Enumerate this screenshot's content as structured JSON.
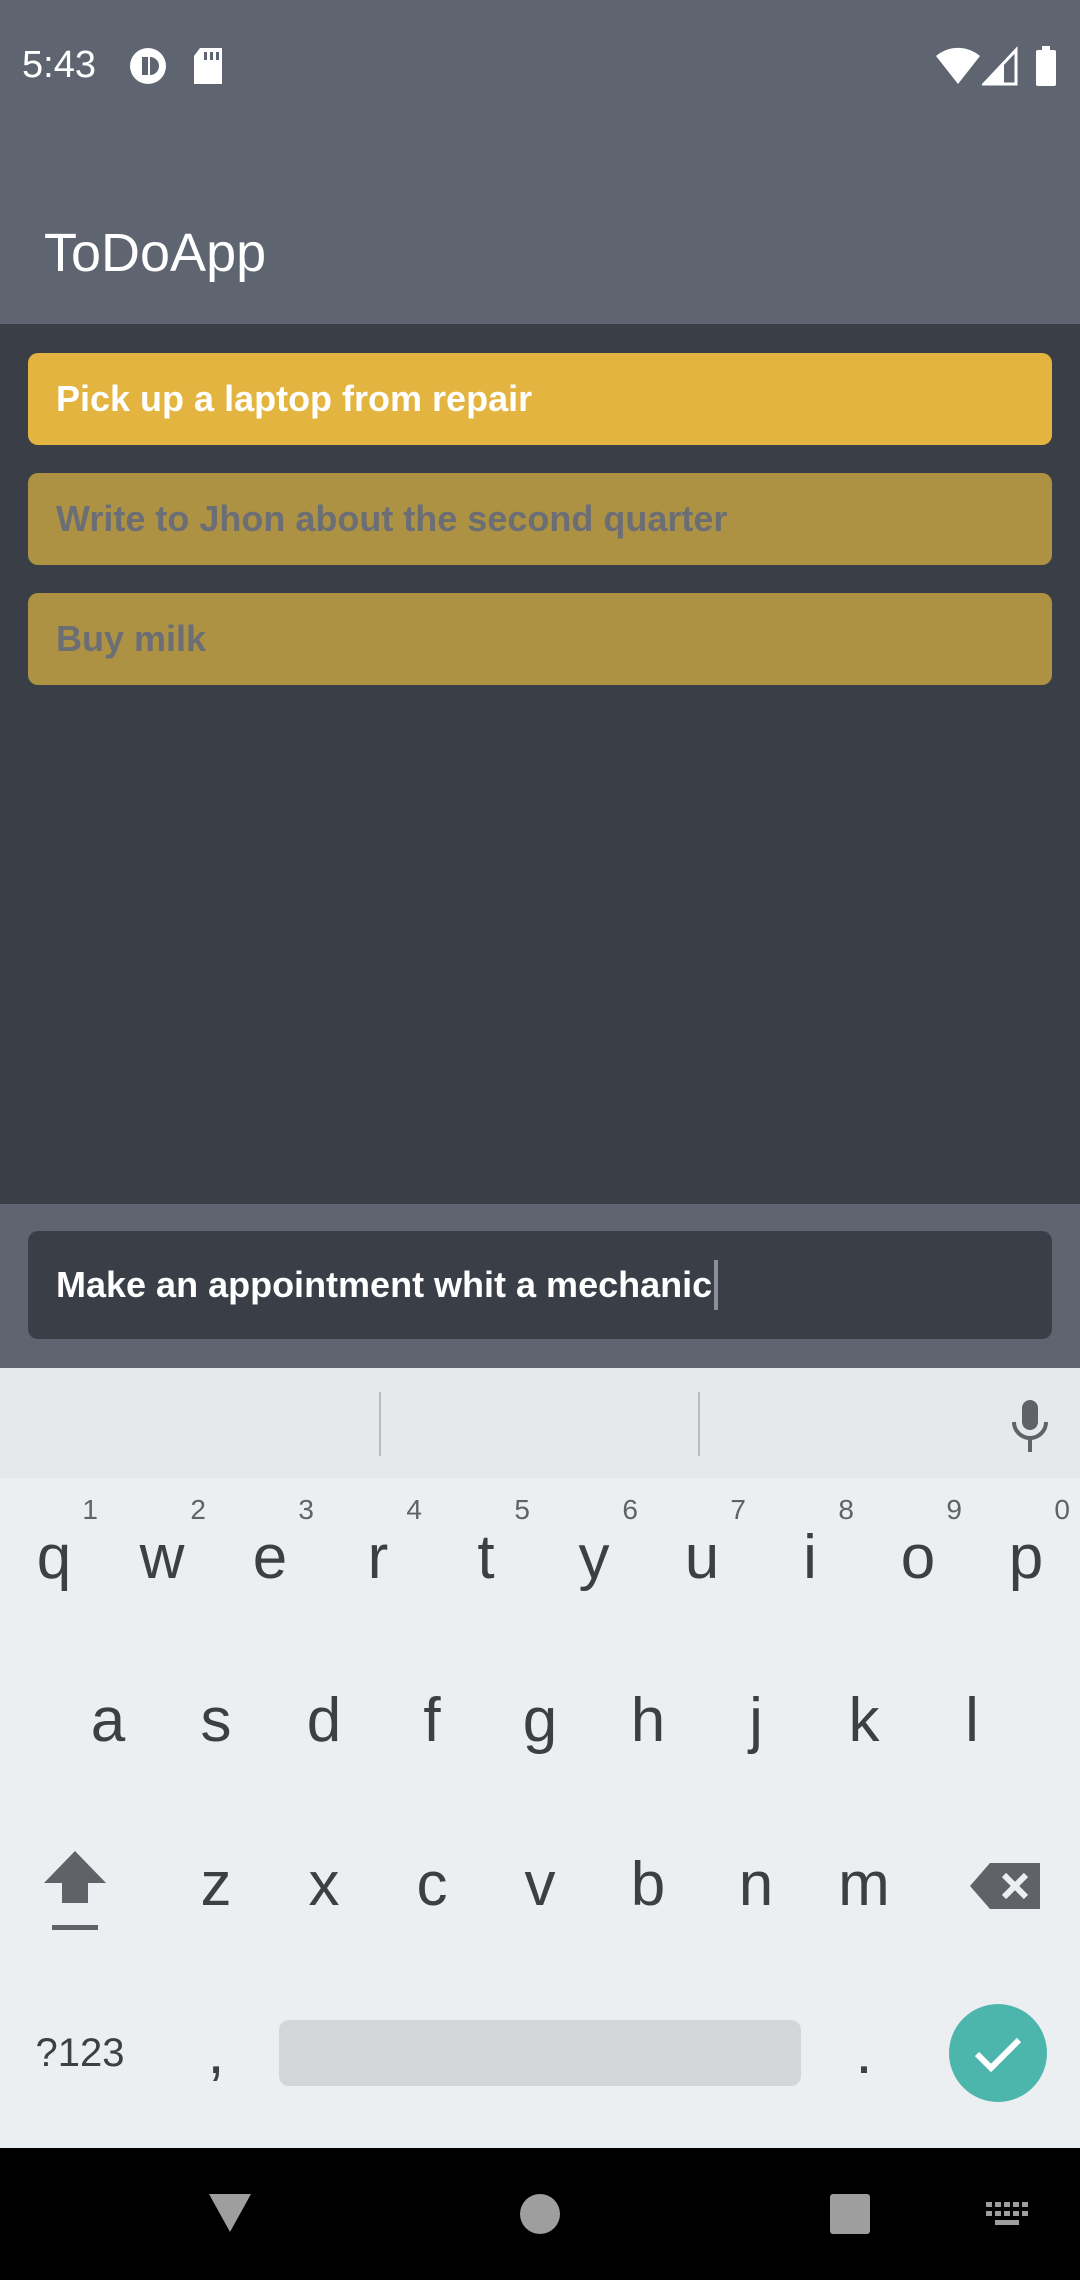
{
  "status_bar": {
    "time": "5:43",
    "icons": [
      "app-notification-icon",
      "sd-card-icon",
      "wifi-icon",
      "signal-icon",
      "battery-icon"
    ]
  },
  "app": {
    "title": "ToDoApp"
  },
  "todos": [
    {
      "text": "Pick up a laptop from repair",
      "state": "active"
    },
    {
      "text": "Write to Jhon about the second quarter",
      "state": "done"
    },
    {
      "text": "Buy milk",
      "state": "done"
    }
  ],
  "input": {
    "value": "Make an appointment whit a mechanic"
  },
  "keyboard": {
    "row1": [
      {
        "key": "q",
        "hint": "1"
      },
      {
        "key": "w",
        "hint": "2"
      },
      {
        "key": "e",
        "hint": "3"
      },
      {
        "key": "r",
        "hint": "4"
      },
      {
        "key": "t",
        "hint": "5"
      },
      {
        "key": "y",
        "hint": "6"
      },
      {
        "key": "u",
        "hint": "7"
      },
      {
        "key": "i",
        "hint": "8"
      },
      {
        "key": "o",
        "hint": "9"
      },
      {
        "key": "p",
        "hint": "0"
      }
    ],
    "row2": [
      "a",
      "s",
      "d",
      "f",
      "g",
      "h",
      "j",
      "k",
      "l"
    ],
    "row3": [
      "z",
      "x",
      "c",
      "v",
      "b",
      "n",
      "m"
    ],
    "symbols_label": "?123",
    "comma": ",",
    "period": "."
  },
  "colors": {
    "app_bar": "#5f6570",
    "background": "#3a3e47",
    "active_item": "#e3b43f",
    "done_item": "#ad9244",
    "enter_key": "#4db6ac"
  }
}
